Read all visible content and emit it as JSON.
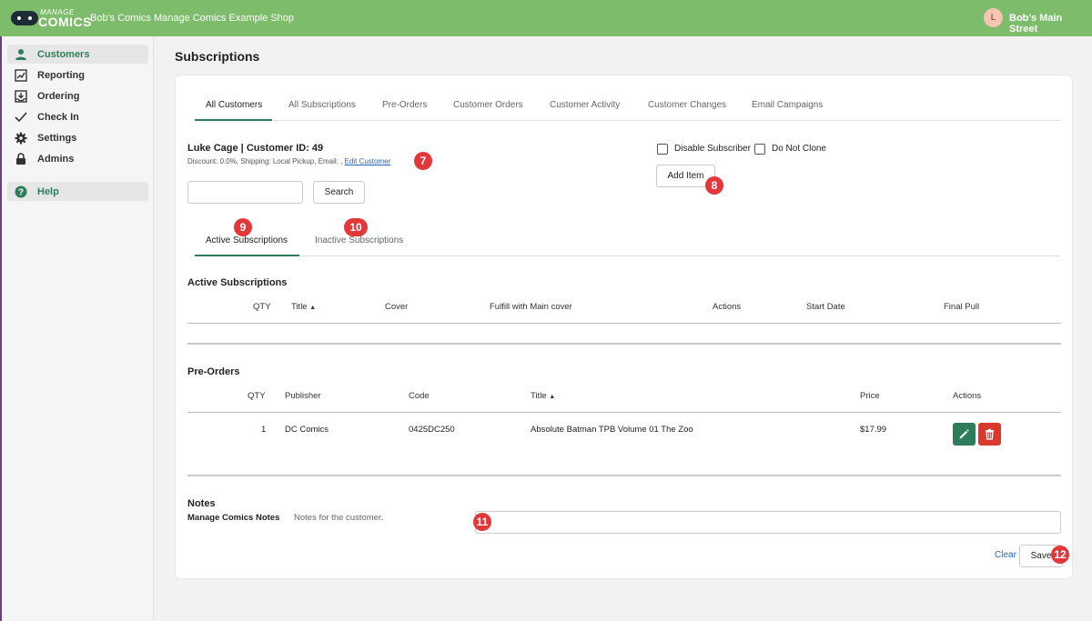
{
  "header": {
    "logo_top": "MANAGE",
    "logo_bottom": "COMICS",
    "shop_name": "Bob's Comics Manage Comics Example Shop",
    "avatar_initial": "L",
    "store_name": "Bob's Main Street"
  },
  "sidebar": {
    "items": [
      {
        "label": "Customers",
        "icon": "person-icon"
      },
      {
        "label": "Reporting",
        "icon": "chart-icon"
      },
      {
        "label": "Ordering",
        "icon": "inbox-download-icon"
      },
      {
        "label": "Check In",
        "icon": "checkmark-icon"
      },
      {
        "label": "Settings",
        "icon": "gear-icon"
      },
      {
        "label": "Admins",
        "icon": "lock-icon"
      },
      {
        "label": "Help",
        "icon": "question-circle-icon"
      }
    ]
  },
  "page": {
    "title": "Subscriptions"
  },
  "tabs": [
    "All Customers",
    "All Subscriptions",
    "Pre-Orders",
    "Customer Orders",
    "Customer Activity",
    "Customer Changes",
    "Email Campaigns"
  ],
  "customer": {
    "name": "Luke Cage | Customer ID: 49",
    "info": "Discount: 0.0%, Shipping: Local Pickup, Email: ,",
    "edit_link": "Edit Customer"
  },
  "search": {
    "value": "",
    "button": "Search"
  },
  "options": {
    "disable_subscriber": "Disable Subscriber",
    "do_not_clone": "Do Not Clone",
    "add_item": "Add Item"
  },
  "subtabs": [
    "Active Subscriptions",
    "Inactive Subscriptions"
  ],
  "active_subscriptions": {
    "title": "Active Subscriptions",
    "columns": [
      "QTY",
      "Title",
      "Cover",
      "Fulfill with Main cover",
      "Actions",
      "Start Date",
      "Final Pull"
    ]
  },
  "pre_orders": {
    "title": "Pre-Orders",
    "columns": [
      "QTY",
      "Publisher",
      "Code",
      "Title",
      "Price",
      "Actions"
    ],
    "rows": [
      {
        "qty": "1",
        "publisher": "DC Comics",
        "code": "0425DC250",
        "title": "Absolute Batman TPB Volume 01 The Zoo",
        "price": "$17.99"
      }
    ]
  },
  "notes": {
    "title": "Notes",
    "label": "Manage Comics Notes",
    "hint": "Notes for the customer.",
    "value": "",
    "clear": "Clear",
    "save": "Save"
  },
  "badges": [
    "7",
    "8",
    "9",
    "10",
    "11",
    "12"
  ],
  "colors": {
    "header_bg": "#7cbc6a",
    "accent": "#2e7d5a",
    "danger": "#d9392c",
    "badge": "#e2383a",
    "link": "#2563c4"
  }
}
